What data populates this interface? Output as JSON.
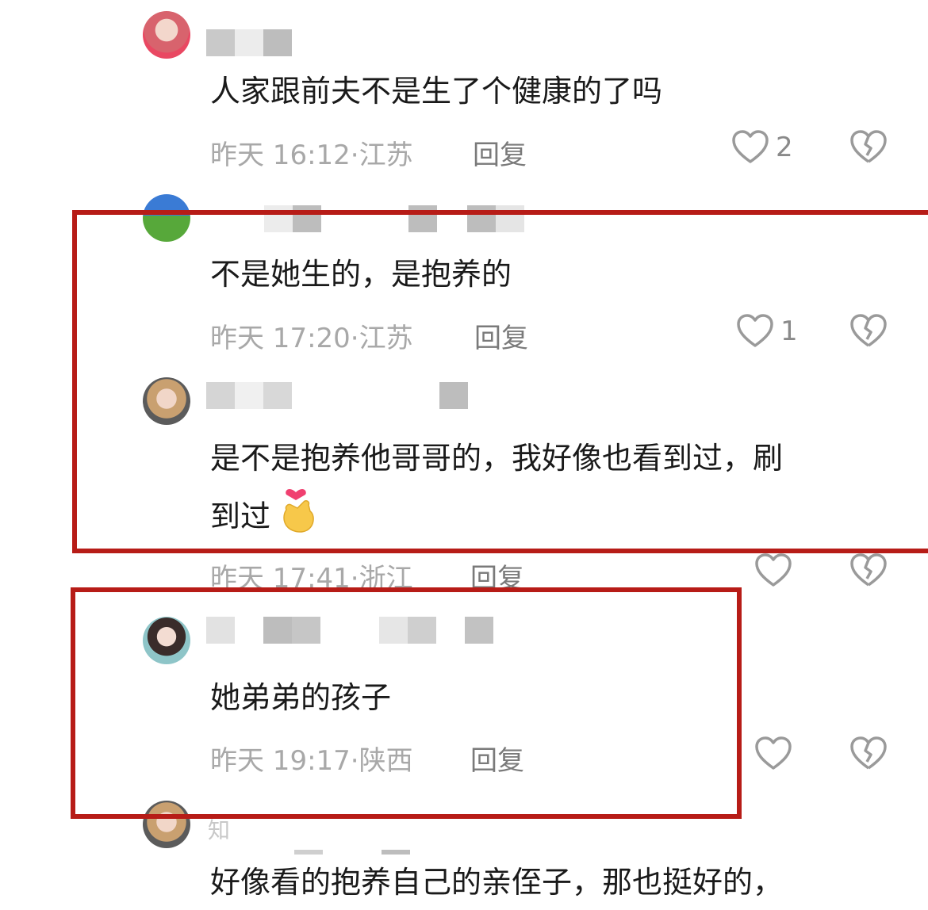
{
  "comments": [
    {
      "text": "人家跟前夫不是生了个健康的了吗",
      "time": "昨天 16:12",
      "location": "江苏",
      "reply": "回复",
      "likes": "2"
    },
    {
      "text": "不是她生的，是抱养的",
      "time": "昨天 17:20",
      "location": "江苏",
      "reply": "回复",
      "likes": "1"
    },
    {
      "text_line1": "是不是抱养他哥哥的，我好像也看到过，刷",
      "text_line2": "到过",
      "time": "昨天 17:41",
      "location": "浙江",
      "reply": "回复",
      "likes": ""
    },
    {
      "text": "她弟弟的孩子",
      "time": "昨天 19:17",
      "location": "陕西",
      "reply": "回复",
      "likes": ""
    },
    {
      "text": "好像看的抱养自己的亲侄子，那也挺好的，",
      "name_partial": "知"
    }
  ],
  "separator": "·",
  "icons": {
    "like": "heart-outline-icon",
    "dislike": "broken-heart-icon",
    "emoji": "finger-heart-emoji"
  },
  "colors": {
    "highlight_border": "#b71c17",
    "meta_text": "#a8a8a8",
    "reply_text": "#7a7a7a"
  }
}
